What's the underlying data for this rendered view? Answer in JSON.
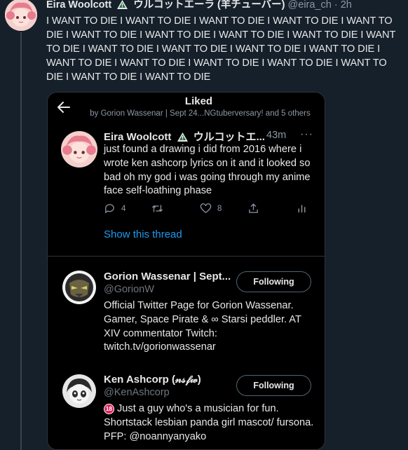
{
  "outer_tweet": {
    "author_name": "Eira Woolcott",
    "author_name_jp": "ウルコットエーラ (羊チューバー)",
    "handle": "@eira_ch",
    "separator": "·",
    "time": "2h",
    "text": "I WANT TO DIE I WANT TO DIE I WANT TO DIE I WANT TO DIE I WANT TO DIE I WANT TO DIE I WANT TO DIE I WANT TO DIE I WANT TO DIE I WANT TO DIE I WANT TO DIE I WANT TO DIE I WANT TO DIE I WANT TO DIE I WANT TO DIE I WANT TO DIE I WANT TO DIE I WANT TO DIE I WANT TO DIE I WANT TO DIE I WANT TO DIE"
  },
  "modal": {
    "title": "Liked",
    "subtitle": "by Gorion Wassenar | Sept 24...NGtuberversary! and 5 others"
  },
  "liked_tweet": {
    "author_name": "Eira Woolcott",
    "author_name_jp": "ウルコットエ...",
    "time": "43m",
    "more": "···",
    "text": "just found a drawing i did from 2016 where i wrote ken ashcorp lyrics on it and it looked so bad oh my god i was going through my anime face self-loathing phase",
    "replies": "4",
    "likes": "8",
    "show_thread": "Show this thread"
  },
  "users": [
    {
      "name": "Gorion Wassenar | Sept...",
      "handle": "@GorionW",
      "button": "Following",
      "bio": "Official Twitter Page for Gorion Wassenar. Gamer, Space Pirate & ∞ Starsi peddler. AT XIV commentator Twitch: twitch.tv/gorionwassenar"
    },
    {
      "name": "Ken Ashcorp (𝓃𝓈𝒻𝓌)",
      "handle": "@KenAshcorp",
      "button": "Following",
      "badge": "18",
      "bio": "Just a guy who's a musician for fun. Shortstack lesbian panda girl mascot/ fursona. PFP: @noannyanyako"
    }
  ],
  "icons": {
    "back": "arrow-left-icon",
    "reply": "reply-icon",
    "retweet": "retweet-icon",
    "like": "heart-icon",
    "share": "share-icon",
    "analytics": "analytics-icon",
    "warning": "warning-triangle-icon"
  },
  "colors": {
    "background": "#15202b",
    "modal": "#000000",
    "link": "#1d9bf0",
    "muted": "#8b98a5"
  }
}
